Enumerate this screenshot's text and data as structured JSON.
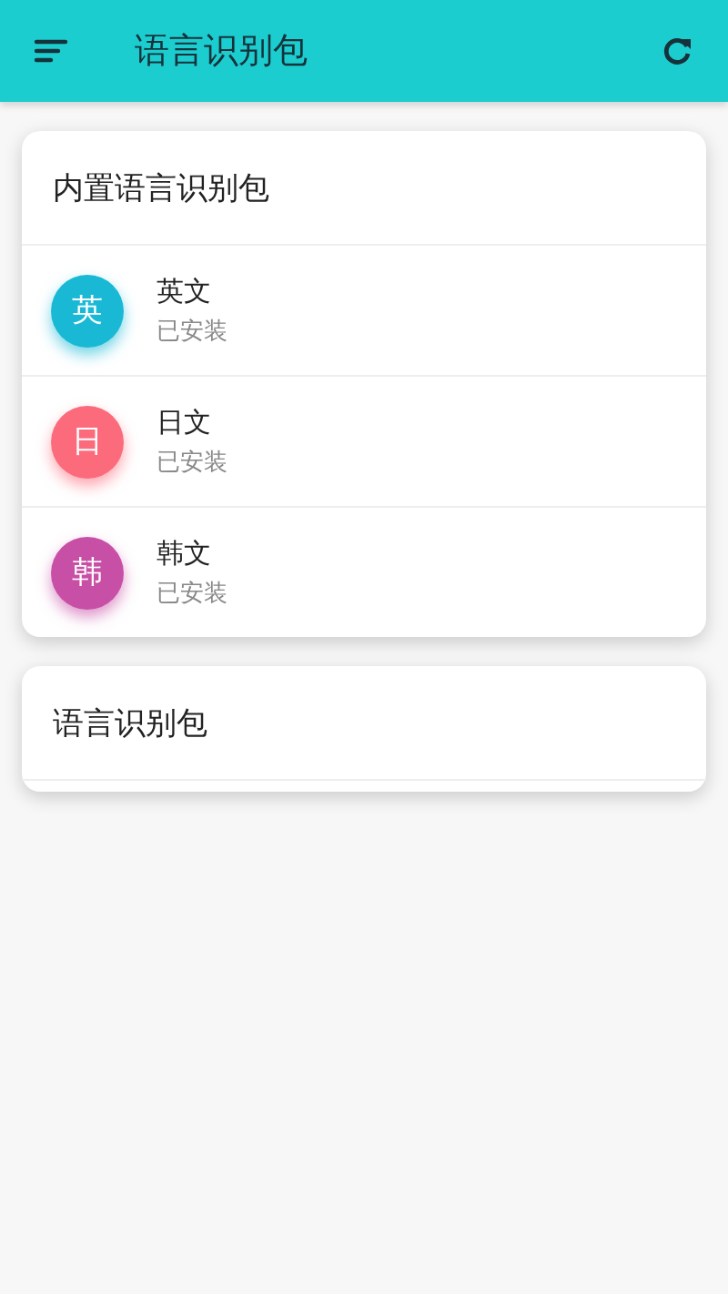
{
  "app_bar": {
    "title": "语言识别包"
  },
  "builtin_card": {
    "title": "内置语言识别包",
    "items": [
      {
        "badge": "英",
        "name": "英文",
        "status": "已安装",
        "color": "#19b9d6"
      },
      {
        "badge": "日",
        "name": "日文",
        "status": "已安装",
        "color": "#fb6b7c"
      },
      {
        "badge": "韩",
        "name": "韩文",
        "status": "已安装",
        "color": "#c84fa6"
      }
    ]
  },
  "packs_card": {
    "title": "语言识别包"
  }
}
